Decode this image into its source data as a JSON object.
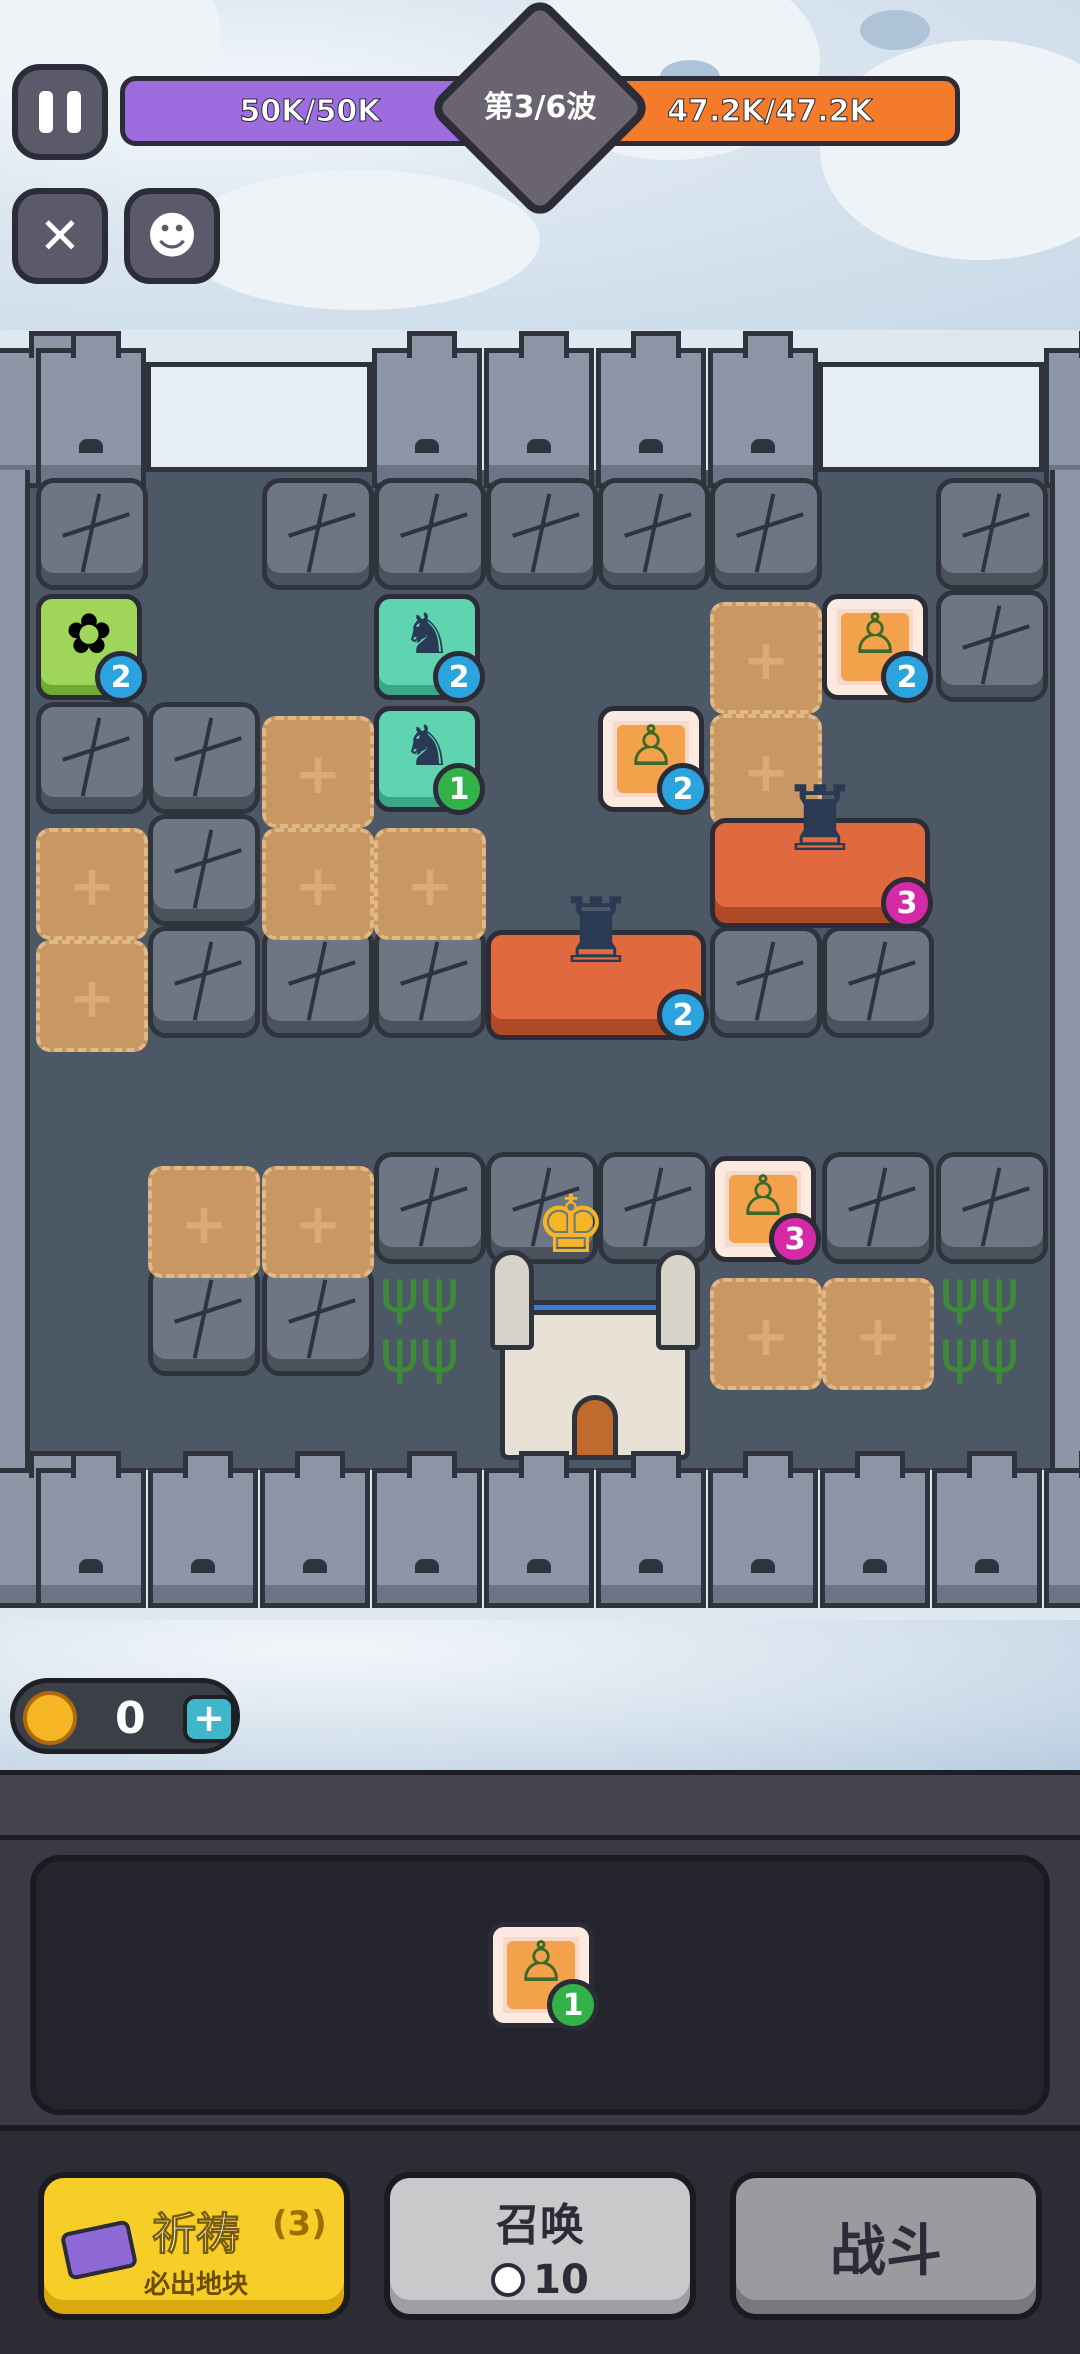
{
  "hud": {
    "player_hp": "50K/50K",
    "wave": "第3/6波",
    "enemy_hp": "47.2K/47.2K"
  },
  "board": {
    "units": [
      {
        "type": "flower",
        "level": "2"
      },
      {
        "type": "mage",
        "level": "2"
      },
      {
        "type": "mage",
        "level": "1"
      },
      {
        "type": "archer",
        "level": "2"
      },
      {
        "type": "archer",
        "level": "2"
      },
      {
        "type": "knight",
        "level": "3"
      },
      {
        "type": "knight",
        "level": "2"
      },
      {
        "type": "archer",
        "level": "3"
      }
    ]
  },
  "resources": {
    "coins": "0",
    "add_symbol": "+"
  },
  "hand": {
    "card_level": "1"
  },
  "actions": {
    "pray_label": "祈祷",
    "pray_count": "(3)",
    "pray_sub": "必出地块",
    "summon_label": "召唤",
    "summon_cost": "10",
    "battle_label": "战斗"
  },
  "colors": {
    "player_bar": "#9d6de0",
    "enemy_bar": "#f47b2a",
    "pray_button": "#f7cd28"
  }
}
